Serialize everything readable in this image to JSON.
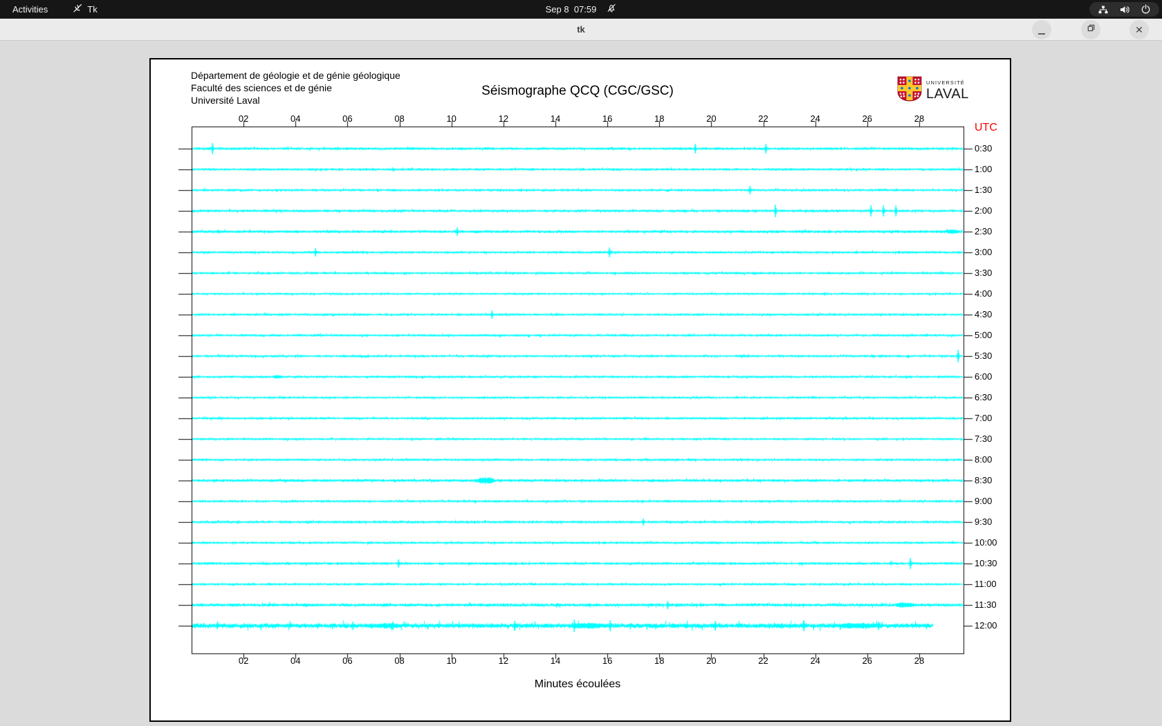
{
  "top_bar": {
    "activities_label": "Activities",
    "app_menu": {
      "icon": "tk-feather-icon",
      "label": "Tk"
    },
    "clock": "Sep 8  07:59",
    "notifications_icon": "bell-slash-icon",
    "system_icons": [
      "network-icon",
      "volume-icon",
      "power-icon"
    ]
  },
  "window": {
    "title": "tk",
    "controls": {
      "restore_icon": "restore-icon",
      "close_glyph": "✕"
    }
  },
  "page": {
    "institution_lines": [
      "Département de géologie et de génie géologique",
      "Faculté des sciences et de génie",
      "Université Laval"
    ],
    "title": "Séismographe QCQ (CGC/GSC)",
    "logo": {
      "top_text": "UNIVERSITÉ",
      "bottom_text": "LAVAL"
    },
    "xlabel": "Minutes écoulées"
  },
  "chart_data": {
    "type": "seismograph",
    "title": "Séismographe QCQ (CGC/GSC)",
    "station": "QCQ (CGC/GSC)",
    "xlabel": "Minutes écoulées",
    "utc_label": "UTC",
    "x_range_minutes": [
      0,
      30
    ],
    "minute_tick_labels": [
      "02",
      "04",
      "06",
      "08",
      "10",
      "12",
      "14",
      "16",
      "18",
      "20",
      "22",
      "24",
      "26",
      "28"
    ],
    "trace_color": "#00ffff",
    "rows": [
      {
        "label": "0:30",
        "amp": 1.4,
        "spikes": [
          [
            307,
            8
          ],
          [
            1005,
            7
          ],
          [
            1107,
            7
          ]
        ],
        "blobs": []
      },
      {
        "label": "1:00",
        "amp": 1.3,
        "spikes": [],
        "blobs": []
      },
      {
        "label": "1:30",
        "amp": 1.3,
        "spikes": [
          [
            1084,
            6
          ]
        ],
        "blobs": []
      },
      {
        "label": "2:00",
        "amp": 1.4,
        "spikes": [
          [
            1121,
            9
          ],
          [
            1259,
            8
          ],
          [
            1277,
            8
          ],
          [
            1295,
            8
          ]
        ],
        "blobs": []
      },
      {
        "label": "2:30",
        "amp": 1.5,
        "spikes": [
          [
            661,
            6
          ]
        ],
        "blobs": [
          [
            1376,
            20,
            3
          ]
        ]
      },
      {
        "label": "3:00",
        "amp": 1.3,
        "spikes": [
          [
            456,
            6
          ],
          [
            881,
            7
          ]
        ],
        "blobs": []
      },
      {
        "label": "3:30",
        "amp": 1.3,
        "spikes": [],
        "blobs": []
      },
      {
        "label": "4:00",
        "amp": 1.2,
        "spikes": [],
        "blobs": []
      },
      {
        "label": "4:30",
        "amp": 1.3,
        "spikes": [
          [
            711,
            6
          ]
        ],
        "blobs": []
      },
      {
        "label": "5:00",
        "amp": 1.3,
        "spikes": [],
        "blobs": []
      },
      {
        "label": "5:30",
        "amp": 1.3,
        "spikes": [
          [
            1385,
            9
          ]
        ],
        "blobs": []
      },
      {
        "label": "6:00",
        "amp": 1.3,
        "spikes": [],
        "blobs": [
          [
            401,
            16,
            2.5
          ]
        ]
      },
      {
        "label": "6:30",
        "amp": 1.2,
        "spikes": [],
        "blobs": []
      },
      {
        "label": "7:00",
        "amp": 1.3,
        "spikes": [],
        "blobs": []
      },
      {
        "label": "7:30",
        "amp": 1.2,
        "spikes": [],
        "blobs": []
      },
      {
        "label": "8:00",
        "amp": 1.3,
        "spikes": [],
        "blobs": []
      },
      {
        "label": "8:30",
        "amp": 1.5,
        "spikes": [],
        "blobs": [
          [
            702,
            26,
            5
          ]
        ]
      },
      {
        "label": "9:00",
        "amp": 1.3,
        "spikes": [],
        "blobs": []
      },
      {
        "label": "9:30",
        "amp": 1.4,
        "spikes": [
          [
            930,
            5
          ]
        ],
        "blobs": []
      },
      {
        "label": "10:00",
        "amp": 1.3,
        "spikes": [],
        "blobs": []
      },
      {
        "label": "10:30",
        "amp": 1.4,
        "spikes": [
          [
            576,
            6
          ],
          [
            1316,
            8
          ]
        ],
        "blobs": []
      },
      {
        "label": "11:00",
        "amp": 1.3,
        "spikes": [],
        "blobs": []
      },
      {
        "label": "11:30",
        "amp": 1.7,
        "spikes": [
          [
            965,
            6
          ]
        ],
        "blobs": [
          [
            1308,
            30,
            4
          ]
        ]
      },
      {
        "label": "12:00",
        "amp": 2.6,
        "end": 1348,
        "spikes": [
          [
            314,
            5
          ],
          [
            510,
            6
          ],
          [
            568,
            6
          ],
          [
            744,
            7
          ],
          [
            830,
            9
          ],
          [
            882,
            8
          ],
          [
            1034,
            7
          ],
          [
            1162,
            8
          ],
          [
            1270,
            6
          ]
        ],
        "blobs": [
          [
            560,
            40,
            4
          ],
          [
            850,
            60,
            4
          ],
          [
            1240,
            60,
            4
          ]
        ]
      }
    ]
  }
}
